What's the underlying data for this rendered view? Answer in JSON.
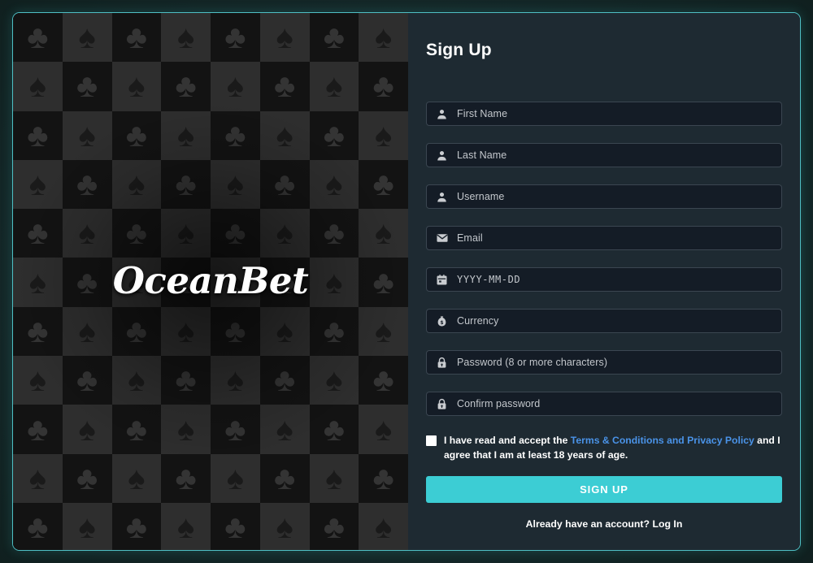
{
  "theme": {
    "accent": "#3ccdd4",
    "border": "#4fbfc4",
    "page_bg": "#1a3330",
    "panel_bg": "#1e2a32",
    "input_bg": "#141c26",
    "link_blue": "#4a93e8"
  },
  "promo": {
    "logo_text": "OceanBet",
    "pattern": {
      "columns": 8,
      "rows": 11,
      "suits": [
        "club",
        "spade"
      ],
      "club_glyph": "♣",
      "spade_glyph": "♠"
    }
  },
  "form": {
    "title": "Sign Up",
    "fields": [
      {
        "name": "first-name",
        "icon": "person-icon",
        "placeholder": "First Name",
        "mono": false
      },
      {
        "name": "last-name",
        "icon": "person-icon",
        "placeholder": "Last Name",
        "mono": false
      },
      {
        "name": "username",
        "icon": "person-icon",
        "placeholder": "Username",
        "mono": false
      },
      {
        "name": "email",
        "icon": "envelope-icon",
        "placeholder": "Email",
        "mono": false
      },
      {
        "name": "date-of-birth",
        "icon": "calendar-icon",
        "placeholder": "YYYY-MM-DD",
        "mono": true
      },
      {
        "name": "currency",
        "icon": "moneybag-icon",
        "placeholder": "Currency",
        "mono": false
      },
      {
        "name": "password",
        "icon": "lock-icon",
        "placeholder": "Password (8 or more characters)",
        "mono": false
      },
      {
        "name": "confirm-password",
        "icon": "lock-icon",
        "placeholder": "Confirm password",
        "mono": false
      }
    ],
    "terms": {
      "checked": false,
      "text_before": "I have read and accept the ",
      "link_text": "Terms & Conditions and Privacy Policy",
      "text_after": " and I agree that I am at least 18 years of age."
    },
    "submit_label": "SIGN UP",
    "login_prompt": "Already have an account? ",
    "login_link": "Log In"
  }
}
